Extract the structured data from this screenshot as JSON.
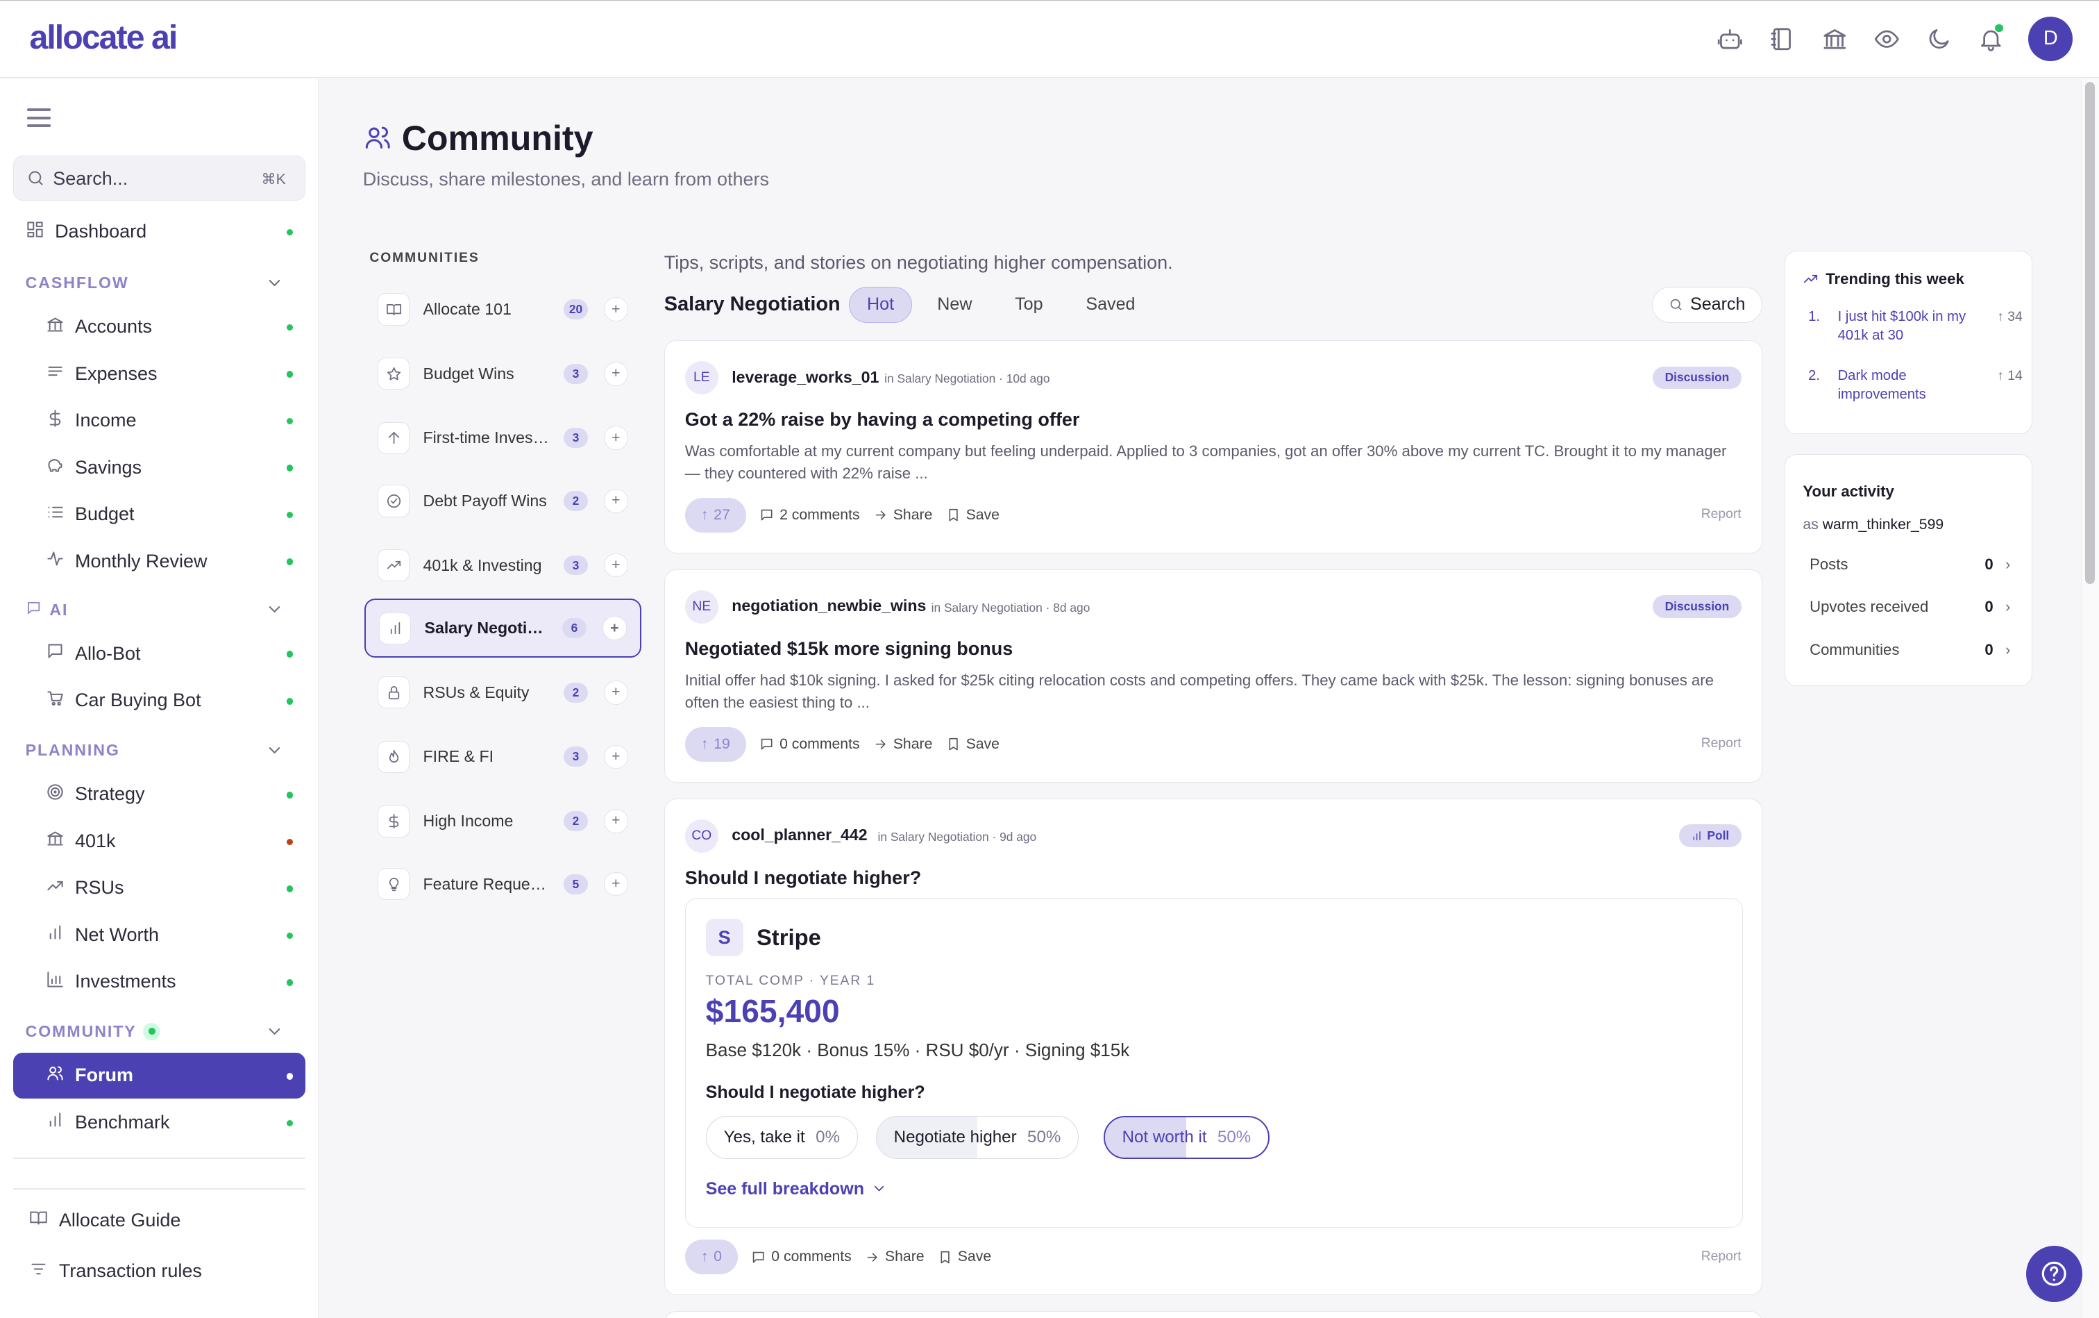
{
  "app": {
    "logo": "allocate ai",
    "avatar_initial": "D"
  },
  "topbar": {
    "icons": [
      "robot-icon",
      "notebook-icon",
      "bank-icon",
      "eye-icon",
      "moon-icon",
      "bell-icon"
    ]
  },
  "sidebar": {
    "search_placeholder": "Search...",
    "search_shortcut": "⌘K",
    "dashboard": "Dashboard",
    "sections": {
      "cashflow": "CASHFLOW",
      "ai": "AI",
      "planning": "PLANNING",
      "community": "COMMUNITY"
    },
    "cashflow": [
      "Accounts",
      "Expenses",
      "Income",
      "Savings",
      "Budget",
      "Monthly Review"
    ],
    "ai": [
      "Allo-Bot",
      "Car Buying Bot"
    ],
    "planning": [
      "Strategy",
      "401k",
      "RSUs",
      "Net Worth",
      "Investments"
    ],
    "community": [
      "Forum",
      "Benchmark"
    ],
    "footer": [
      "Allocate Guide",
      "Transaction rules"
    ],
    "status_colors": {
      "ok": "#22c55e",
      "alert": "#c2410c"
    }
  },
  "header": {
    "title": "Community",
    "subtitle": "Discuss, share milestones, and learn from others"
  },
  "communities": {
    "label": "COMMUNITIES",
    "items": [
      {
        "name": "Allocate 101",
        "count": "20"
      },
      {
        "name": "Budget Wins",
        "count": "3"
      },
      {
        "name": "First-time Investors",
        "count": "3"
      },
      {
        "name": "Debt Payoff Wins",
        "count": "2"
      },
      {
        "name": "401k & Investing",
        "count": "3"
      },
      {
        "name": "Salary Negotiation",
        "count": "6"
      },
      {
        "name": "RSUs & Equity",
        "count": "2"
      },
      {
        "name": "FIRE & FI",
        "count": "3"
      },
      {
        "name": "High Income",
        "count": "2"
      },
      {
        "name": "Feature Requests",
        "count": "5"
      }
    ]
  },
  "feed": {
    "tagline": "Tips, scripts, and stories on negotiating higher compensation.",
    "name": "Salary Negotiation",
    "tabs": [
      "Hot",
      "New",
      "Top",
      "Saved"
    ],
    "search_label": "Search",
    "share_label": "Share",
    "save_label": "Save",
    "report_label": "Report",
    "posts": [
      {
        "initials": "LE",
        "user": "leverage_works_01",
        "meta": "in Salary Negotiation · 10d ago",
        "badge": "Discussion",
        "title": "Got a 22% raise by having a competing offer",
        "body": "Was comfortable at my current company but feeling underpaid. Applied to 3 companies, got an offer 30% above my current TC. Brought it to my manager — they countered with 22% raise ...",
        "votes": "27",
        "comments": "2 comments"
      },
      {
        "initials": "NE",
        "user": "negotiation_newbie_wins",
        "meta": "in Salary Negotiation · 8d ago",
        "badge": "Discussion",
        "title": "Negotiated $15k more signing bonus",
        "body": "Initial offer had $10k signing. I asked for $25k citing relocation costs and competing offers. They came back with $25k. The lesson: signing bonuses are often the easiest thing to ...",
        "votes": "19",
        "comments": "0 comments"
      },
      {
        "initials": "CO",
        "user": "cool_planner_442",
        "meta": "in Salary Negotiation · 9d ago",
        "badge": "Poll",
        "title": "Should I negotiate higher?",
        "votes": "0",
        "comments": "0 comments",
        "poll": {
          "logo": "S",
          "company": "Stripe",
          "label": "TOTAL COMP · YEAR 1",
          "amount": "$165,400",
          "details": "Base $120k · Bonus 15% · RSU $0/yr · Signing $15k",
          "question": "Should I negotiate higher?",
          "options": [
            {
              "label": "Yes, take it",
              "pct": "0%",
              "fill": 0
            },
            {
              "label": "Negotiate higher",
              "pct": "50%",
              "fill": 50
            },
            {
              "label": "Not worth it",
              "pct": "50%",
              "fill": 50,
              "selected": true
            }
          ],
          "breakdown": "See full breakdown"
        }
      }
    ]
  },
  "trending": {
    "title": "Trending this week",
    "items": [
      {
        "rank": "1.",
        "title": "I just hit $100k in my 401k at 30",
        "votes": "34"
      },
      {
        "rank": "2.",
        "title": "Dark mode improvements",
        "votes": "14"
      }
    ]
  },
  "activity": {
    "title": "Your activity",
    "as_label": "as",
    "as_user": "warm_thinker_599",
    "rows": [
      {
        "label": "Posts",
        "value": "0"
      },
      {
        "label": "Upvotes received",
        "value": "0"
      },
      {
        "label": "Communities",
        "value": "0"
      }
    ]
  }
}
